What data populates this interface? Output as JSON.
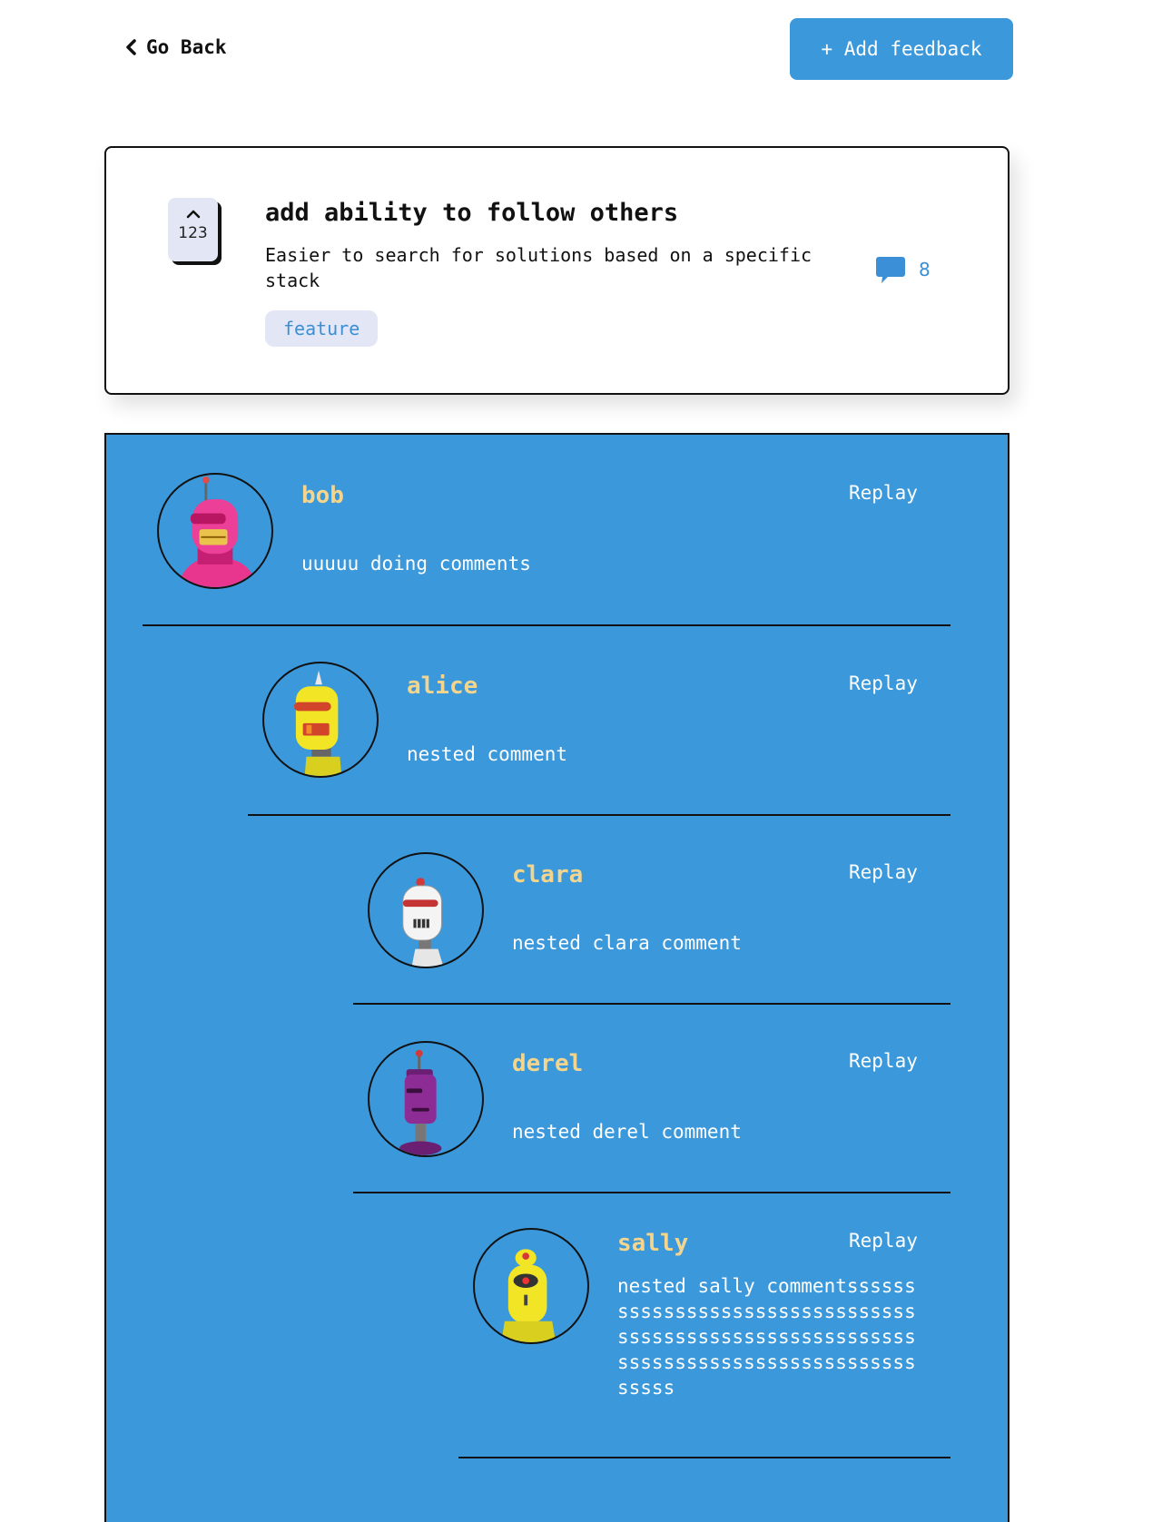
{
  "nav": {
    "back_label": "Go Back",
    "add_feedback_label": "+ Add feedback"
  },
  "feedback": {
    "upvotes": "123",
    "title": "add ability to follow others",
    "description": "Easier to search for solutions based on a specific stack",
    "tag": "feature",
    "comment_count": "8"
  },
  "comments": [
    {
      "name": "bob",
      "text": "uuuuu doing comments",
      "reply_label": "Replay",
      "avatar_color": "#e8358d"
    },
    {
      "name": "alice",
      "text": "nested comment",
      "reply_label": "Replay",
      "avatar_color": "#f2e526"
    },
    {
      "name": "clara",
      "text": "nested clara comment",
      "reply_label": "Replay",
      "avatar_color": "#f0f0f0"
    },
    {
      "name": "derel",
      "text": "nested derel comment",
      "reply_label": "Replay",
      "avatar_color": "#8e2c96"
    },
    {
      "name": "sally",
      "text": "nested sally commentsssssssssssssssssssssssssssssssssssssssssssssssssssssssssssssssssssssssssssssssssssssssss",
      "reply_label": "Replay",
      "avatar_color": "#f2e526"
    }
  ],
  "colors": {
    "accent": "#3a98db",
    "name": "#f4d58d",
    "tag_bg": "#e3e6f4"
  }
}
